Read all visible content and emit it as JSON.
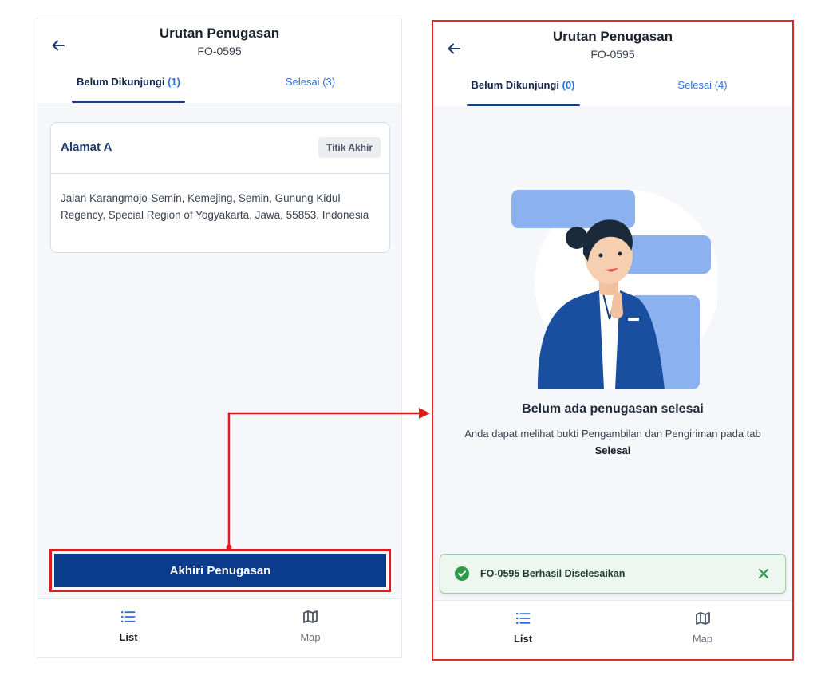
{
  "colors": {
    "brand_primary": "#0b3c8c",
    "accent_link": "#2d6fd6",
    "highlight_red": "#e01d1d",
    "success_green": "#2e9b4b",
    "illustration_blue": "#8bb2ee"
  },
  "left_screen": {
    "header": {
      "title": "Urutan Penugasan",
      "subtitle": "FO-0595",
      "back_icon": "arrow-left-icon"
    },
    "tabs": [
      {
        "label": "Belum Dikunjungi",
        "count": "(1)",
        "active": true
      },
      {
        "label": "Selesai",
        "count": "(3)",
        "active": false
      }
    ],
    "address_card": {
      "title": "Alamat A",
      "badge": "Titik Akhir",
      "address": "Jalan Karangmojo-Semin, Kemejing, Semin, Gunung Kidul Regency, Special Region of Yogyakarta, Jawa, 55853, Indonesia"
    },
    "end_button_label": "Akhiri Penugasan",
    "bottom_nav": [
      {
        "label": "List",
        "icon": "list-icon",
        "active": true
      },
      {
        "label": "Map",
        "icon": "map-icon",
        "active": false
      }
    ]
  },
  "right_screen": {
    "header": {
      "title": "Urutan Penugasan",
      "subtitle": "FO-0595",
      "back_icon": "arrow-left-icon"
    },
    "tabs": [
      {
        "label": "Belum Dikunjungi",
        "count": "(0)",
        "active": true
      },
      {
        "label": "Selesai",
        "count": "(4)",
        "active": false
      }
    ],
    "empty_state": {
      "title": "Belum ada penugasan selesai",
      "desc_before": "Anda dapat melihat bukti Pengambilan dan Pengiriman pada tab ",
      "desc_bold": "Selesai"
    },
    "toast": {
      "message": "FO-0595 Berhasil Diselesaikan",
      "icon": "check-circle-icon",
      "close_icon": "close-icon"
    },
    "bottom_nav": [
      {
        "label": "List",
        "icon": "list-icon",
        "active": true
      },
      {
        "label": "Map",
        "icon": "map-icon",
        "active": false
      }
    ]
  }
}
